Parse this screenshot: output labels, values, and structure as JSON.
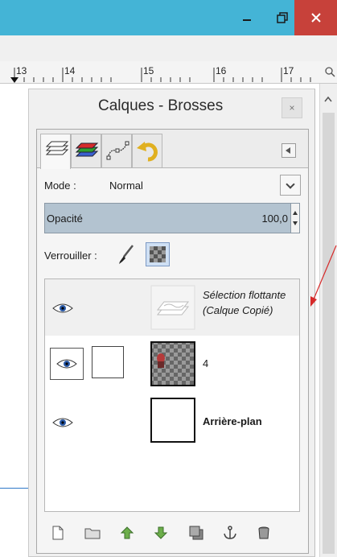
{
  "window": {
    "controls": {
      "minimize": "minimize",
      "maximize": "maximize",
      "close": "close"
    }
  },
  "ruler": {
    "ticks": [
      "13",
      "14",
      "15",
      "16",
      "17"
    ]
  },
  "dock": {
    "title": "Calques - Brosses",
    "close_label": "×",
    "tabs": [
      {
        "name": "layers-tab-icon",
        "active": true
      },
      {
        "name": "channels-tab-icon",
        "active": false
      },
      {
        "name": "paths-tab-icon",
        "active": false
      },
      {
        "name": "undo-history-tab-icon",
        "active": false
      }
    ]
  },
  "layers_panel": {
    "mode_label": "Mode :",
    "mode_value": "Normal",
    "opacity_label": "Opacité",
    "opacity_value": "100,0",
    "lock_label": "Verrouiller :",
    "layers": [
      {
        "name_line1": "Sélection flottante",
        "name_line2": "(Calque Copié)",
        "visible": true,
        "selected": true,
        "style": "italic"
      },
      {
        "name_line1": "4",
        "visible": true,
        "selected": false,
        "style": "normal"
      },
      {
        "name_line1": "Arrière-plan",
        "visible": true,
        "selected": false,
        "style": "bold"
      }
    ],
    "bottom_actions": [
      "new-layer-icon",
      "new-layer-group-icon",
      "raise-layer-icon",
      "lower-layer-icon",
      "duplicate-layer-icon",
      "anchor-layer-icon",
      "delete-layer-icon"
    ]
  },
  "colors": {
    "titlebar": "#44b4d6",
    "close_button": "#c7413a",
    "opacity_bar": "#b3c3d0",
    "annotation_arrow": "#d62a2a"
  }
}
